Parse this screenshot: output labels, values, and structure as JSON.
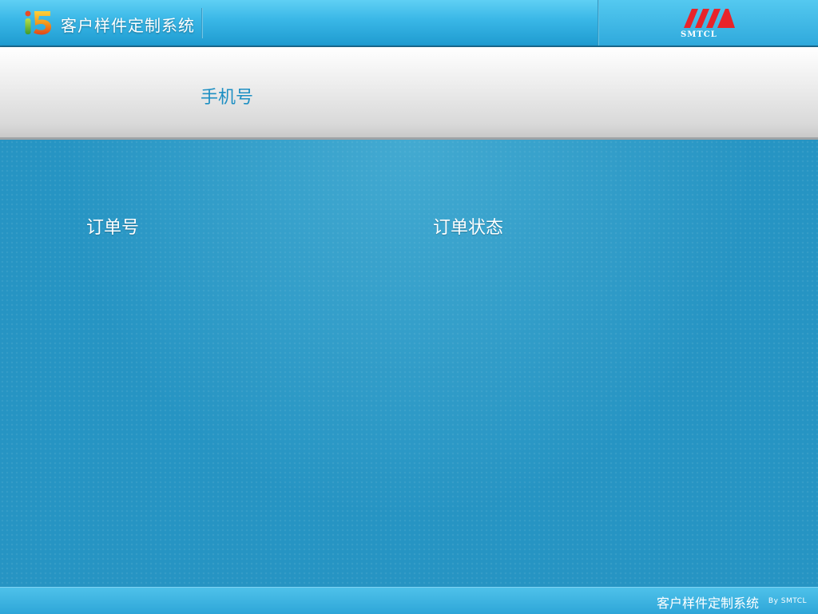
{
  "header": {
    "logo": "i5",
    "title": "客户样件定制系统",
    "brand_logo_text": "SMTCL"
  },
  "form": {
    "phone_label": "手机号"
  },
  "table": {
    "columns": [
      "订单号",
      "订单状态"
    ]
  },
  "footer": {
    "title": "客户样件定制系统",
    "by": "By SMTCL"
  },
  "colors": {
    "header_blue": "#38b6e6",
    "main_blue": "#2694c3",
    "label_blue": "#1d8fc3",
    "brand_red": "#e8242a"
  }
}
